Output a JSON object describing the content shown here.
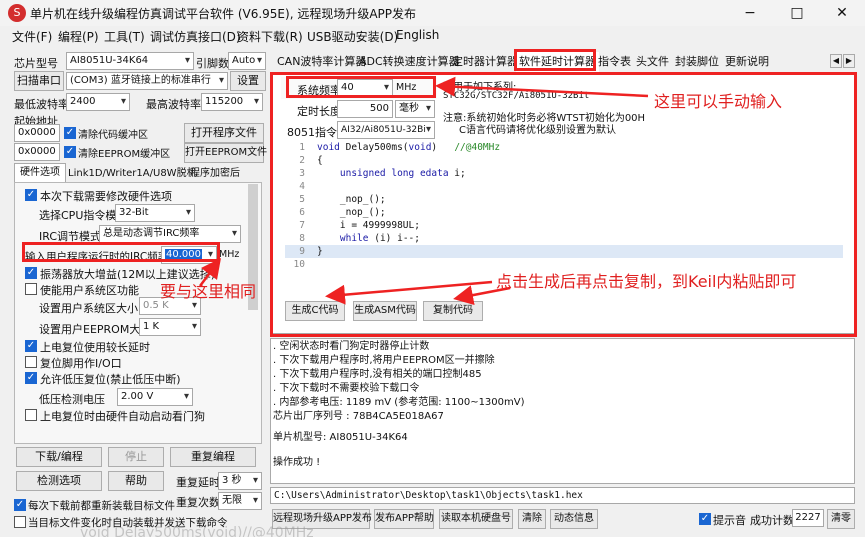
{
  "window": {
    "title": "单片机在线升级编程仿真调试平台软件 (V6.95E), 远程现场升级APP发布",
    "icon": "chip-logo-icon",
    "controls": [
      "−",
      "□",
      "✕"
    ]
  },
  "menu": [
    "文件(F)",
    "编程(P)",
    "工具(T)",
    "调试仿真接口(D)",
    "资料下载(R)",
    "USB驱动安装(D)",
    "English"
  ],
  "left": {
    "chip_label": "芯片型号",
    "chip_value": "AI8051U-34K64",
    "pin_label": "引脚数",
    "pin_value": "Auto",
    "scan_button": "扫描串口",
    "port_value": "(COM3) 蓝牙链接上的标准串行",
    "settings_button": "设置",
    "min_baud_label": "最低波特率",
    "min_baud_value": "2400",
    "max_baud_label": "最高波特率",
    "max_baud_value": "115200",
    "start_addr_label": "起始地址",
    "addr1_value": "0x0000",
    "clear_code_label": "清除代码缓冲区",
    "open_prog_button": "打开程序文件",
    "addr2_value": "0x0000",
    "clear_eeprom_label": "清除EEPROM缓冲区",
    "open_eeprom_button": "打开EEPROM文件",
    "tabs": [
      "硬件选项",
      "Link1D/Writer1A/U8W脱机",
      "程序加密后"
    ],
    "hw": {
      "modify_label": "本次下载需要修改硬件选项",
      "cpu_mode_label": "选择CPU指令模式",
      "cpu_mode_value": "32-Bit",
      "irc_mode_label": "IRC调节模式",
      "irc_mode_value": "总是动态调节IRC频率",
      "irc_freq_label": "输入用户程序运行时的IRC频率",
      "irc_freq_value": "40.000",
      "irc_freq_unit": "MHz",
      "osc_label": "振荡器放大增益(12M以上建议选择)",
      "sysfreq_label": "使能用户系统区功能",
      "sys_size_label": "设置用户系统区大小",
      "sys_size_value": "0.5 K",
      "eeprom_size_label": "设置用户EEPROM大小",
      "eeprom_size_value": "1   K",
      "reset_delay_label": "上电复位使用较长延时",
      "reset_io_label": "复位脚用作I/O口",
      "lvd_label": "允许低压复位(禁止低压中断)",
      "lvd_voltage_label": "低压检测电压",
      "lvd_voltage_value": "2.00 V",
      "watchdog_label": "上电复位时由硬件自动启动看门狗"
    },
    "download_button": "下载/编程",
    "stop_button": "停止",
    "reprogram_button": "重复编程",
    "detect_button": "检测选项",
    "help_button": "帮助",
    "repeat_delay_label": "重复延时",
    "repeat_delay_value": "3 秒",
    "repeat_count_label": "重复次数",
    "repeat_count_value": "无限",
    "reload_label": "每次下载前都重新装载目标文件",
    "autoload_label": "当目标文件变化时自动装载并发送下载命令"
  },
  "right": {
    "tabs": [
      "CAN波特率计算器",
      "ADC转换速度计算器",
      "定时器计算器",
      "软件延时计算器",
      "指令表",
      "头文件",
      "封装脚位",
      "更新说明"
    ],
    "active_tab": "软件延时计算器",
    "sysfreq_label": "系统频率",
    "sysfreq_value": "40",
    "sysfreq_unit": "MHz",
    "delay_label": "定时长度",
    "delay_value": "500",
    "delay_unit": "毫秒",
    "isa_label": "8051指令集",
    "isa_value": "AI32/Ai8051U-32Bi",
    "applies_line1": "适用于如下系列:",
    "applies_line2": "STC32G/STC32F/Ai8051U-32Bit",
    "note_line1": "注意:系统初始化时务必将WTST初始化为00H",
    "note_line2": "C语言代码请将优化级别设置为默认",
    "code_lines": [
      {
        "n": "1",
        "t": "void Delay500ms(void)   //@40MHz"
      },
      {
        "n": "2",
        "t": "{"
      },
      {
        "n": "3",
        "t": "    unsigned long edata i;"
      },
      {
        "n": "4",
        "t": ""
      },
      {
        "n": "5",
        "t": "    _nop_();"
      },
      {
        "n": "6",
        "t": "    _nop_();"
      },
      {
        "n": "7",
        "t": "    i = 4999998UL;"
      },
      {
        "n": "8",
        "t": "    while (i) i--;"
      },
      {
        "n": "9",
        "t": "}"
      },
      {
        "n": "10",
        "t": ""
      }
    ],
    "gen_c_button": "生成C代码",
    "gen_asm_button": "生成ASM代码",
    "copy_button": "复制代码",
    "log_lines": [
      ". 空闲状态时看门狗定时器停止计数",
      ". 下次下载用户程序时,将用户EEPROM区一并擦除",
      ". 下次下载用户程序时,没有相关的端口控制485",
      ". 下次下载时不需要校验下载口令",
      ". 内部参考电压: 1189 mV (参考范围: 1100~1300mV)",
      "芯片出厂序列号 : 78B4CA5E018A67",
      "",
      "  单片机型号: AI8051U-34K64",
      "",
      "操作成功 !"
    ],
    "path": "C:\\Users\\Administrator\\Desktop\\task1\\Objects\\task1.hex"
  },
  "bottom": {
    "publish_button": "远程现场升级APP发布",
    "publish_help_button": "发布APP帮助",
    "read_disk_button": "读取本机硬盘号",
    "clear_button": "清除",
    "dynamic_info_button": "动态信息",
    "sound_label": "提示音",
    "success_count_label": "成功计数",
    "success_count_value": "2227",
    "clear_count_button": "清零"
  },
  "annotations": {
    "manual_input": "这里可以手动输入",
    "same_here": "要与这里相同",
    "copy_hint": "点击生成后再点击复制，到Keil内粘贴即可"
  },
  "overlay_text": "void Delay500ms(void)//@40MHz",
  "colors": {
    "annotation_red": "#e22222",
    "check_blue": "#1a66d2",
    "code_keyword": "#1a1aa6",
    "code_comment": "#2a8a2a"
  }
}
